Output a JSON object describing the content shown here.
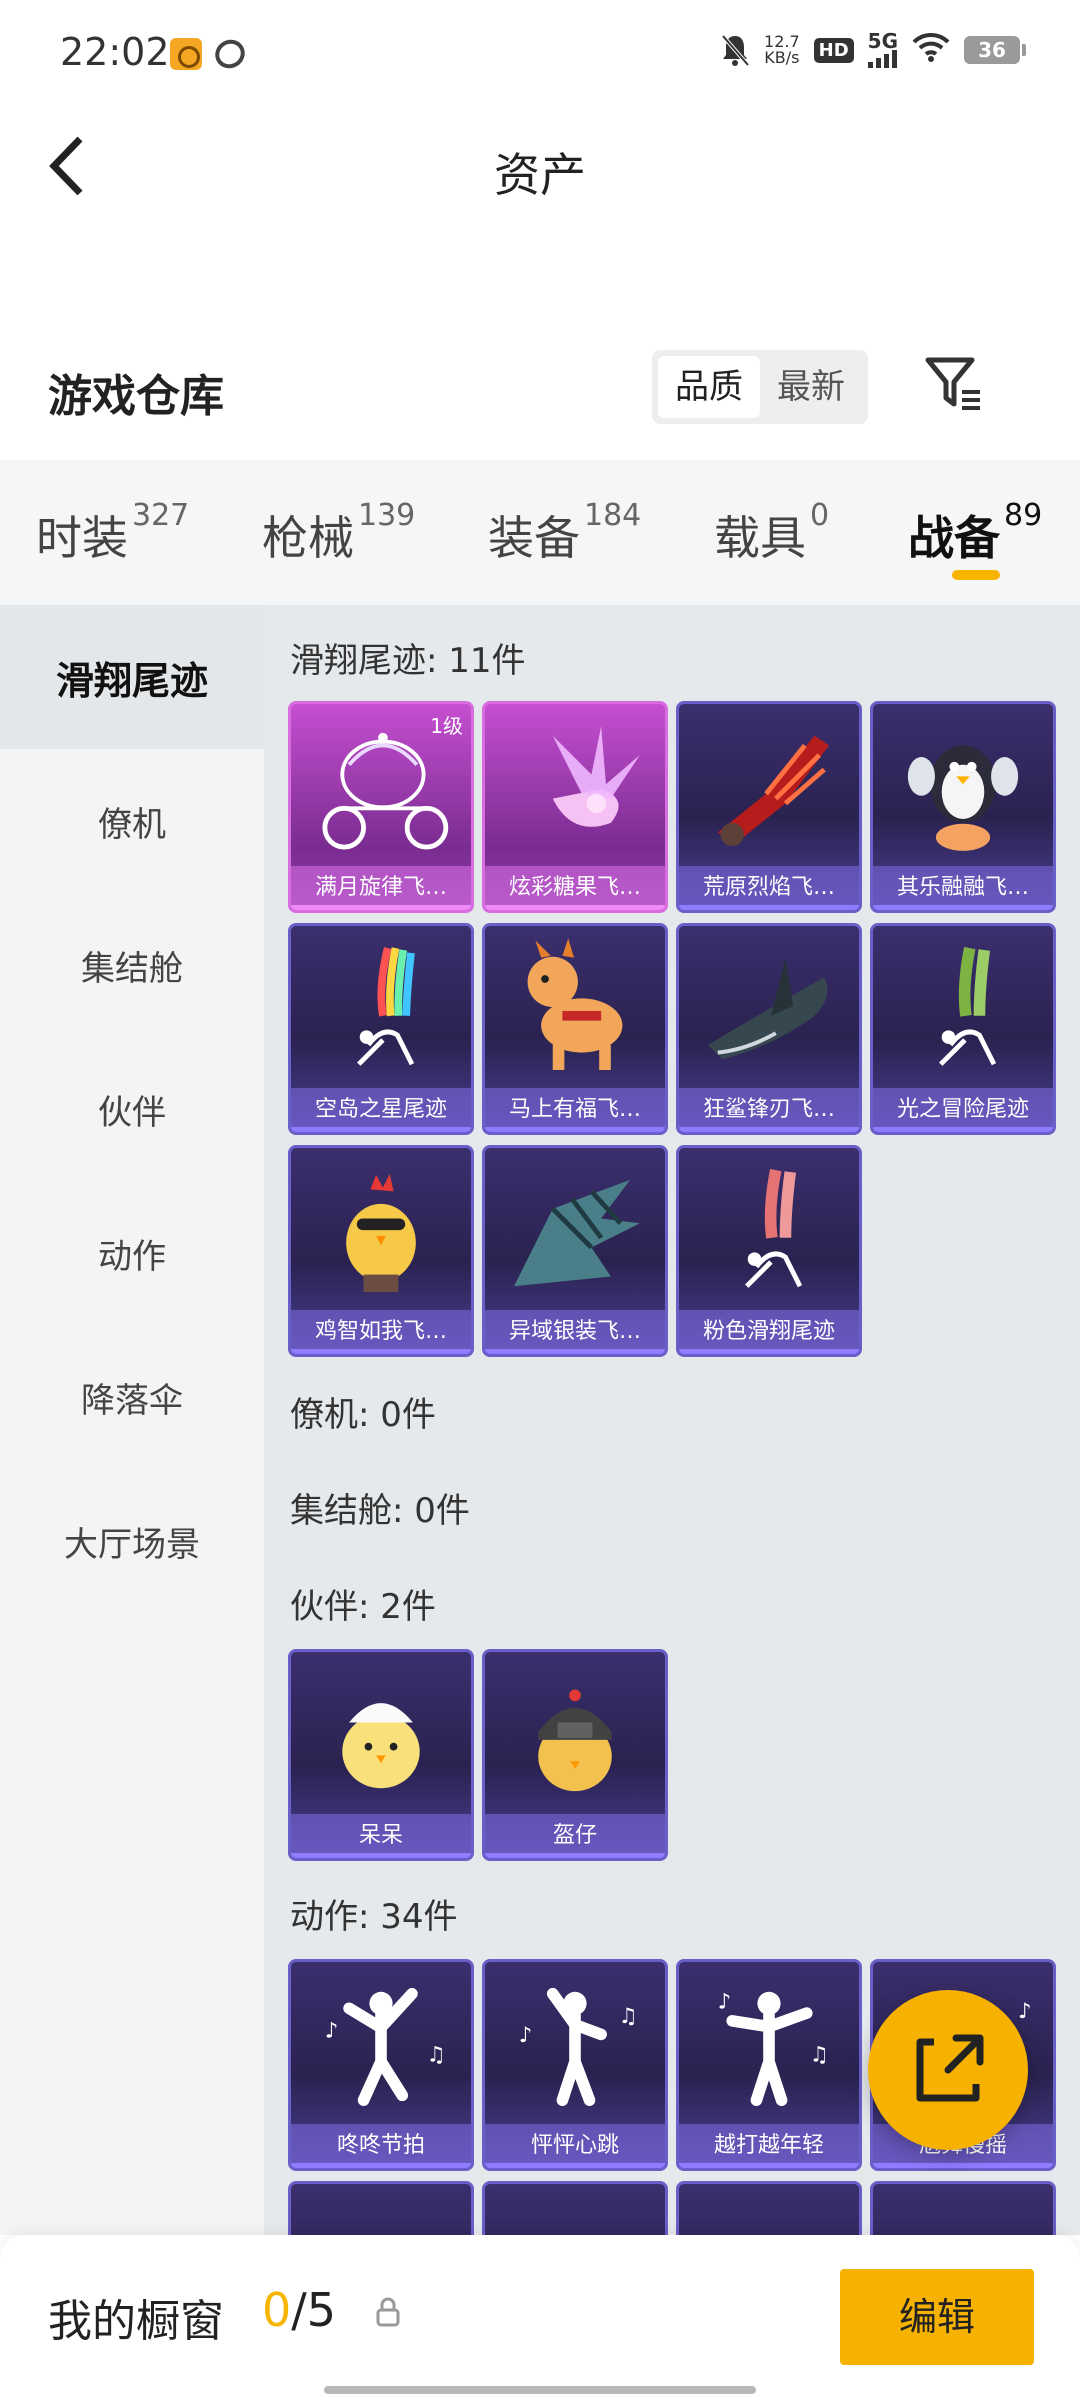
{
  "status_bar": {
    "time": "22:02",
    "speed_value": "12.7",
    "speed_unit": "KB/s",
    "hd": "HD",
    "network": "5G",
    "battery": "36"
  },
  "header": {
    "title": "资产"
  },
  "warehouse": {
    "title": "游戏仓库",
    "sort_options": [
      "品质",
      "最新"
    ],
    "sort_selected": "品质"
  },
  "tabs": [
    {
      "label": "时装",
      "count": "327"
    },
    {
      "label": "枪械",
      "count": "139"
    },
    {
      "label": "装备",
      "count": "184"
    },
    {
      "label": "载具",
      "count": "0"
    },
    {
      "label": "战备",
      "count": "89",
      "active": true
    }
  ],
  "sidebar": {
    "items": [
      "滑翔尾迹",
      "僚机",
      "集结舱",
      "伙伴",
      "动作",
      "降落伞",
      "大厅场景"
    ],
    "active": "滑翔尾迹"
  },
  "sections": {
    "glide": {
      "title": "滑翔尾迹: 11件",
      "items": [
        {
          "name": "满月旋律飞…",
          "level": "1级",
          "tier": "purple",
          "art": "carriage"
        },
        {
          "name": "炫彩糖果飞…",
          "tier": "purple",
          "art": "candy"
        },
        {
          "name": "荒原烈焰飞…",
          "tier": "blue",
          "art": "flame-wing"
        },
        {
          "name": "其乐融融飞…",
          "tier": "blue",
          "art": "penguin"
        },
        {
          "name": "空岛之星尾迹",
          "tier": "blue",
          "art": "rainbow-trail"
        },
        {
          "name": "马上有福飞…",
          "tier": "blue",
          "art": "horse"
        },
        {
          "name": "狂鲨锋刃飞…",
          "tier": "blue",
          "art": "shark"
        },
        {
          "name": "光之冒险尾迹",
          "tier": "blue",
          "art": "green-trail"
        },
        {
          "name": "鸡智如我飞…",
          "tier": "blue",
          "art": "chicken"
        },
        {
          "name": "异域银装飞…",
          "tier": "blue",
          "art": "wing-blade"
        },
        {
          "name": "粉色滑翔尾迹",
          "tier": "blue",
          "art": "pink-trail"
        }
      ]
    },
    "wingman": {
      "title": "僚机: 0件"
    },
    "pod": {
      "title": "集结舱: 0件"
    },
    "partner": {
      "title": "伙伴: 2件",
      "items": [
        {
          "name": "呆呆",
          "tier": "blue",
          "art": "chick"
        },
        {
          "name": "盔仔",
          "tier": "blue",
          "art": "helmet-chick"
        }
      ]
    },
    "emote": {
      "title": "动作: 34件",
      "items": [
        {
          "name": "咚咚节拍",
          "tier": "blue",
          "art": "dancer"
        },
        {
          "name": "怦怦心跳",
          "tier": "blue",
          "art": "dancer"
        },
        {
          "name": "越打越年轻",
          "tier": "blue",
          "art": "dancer"
        },
        {
          "name": "尬舞慢摇",
          "tier": "blue",
          "art": "dancer"
        }
      ]
    }
  },
  "bottom": {
    "label": "我的橱窗",
    "used": "0",
    "total": "/5",
    "edit": "编辑"
  },
  "colors": {
    "accent": "#f7b100",
    "card_blue": "#2a2250",
    "card_purple": "#c54fd0"
  }
}
